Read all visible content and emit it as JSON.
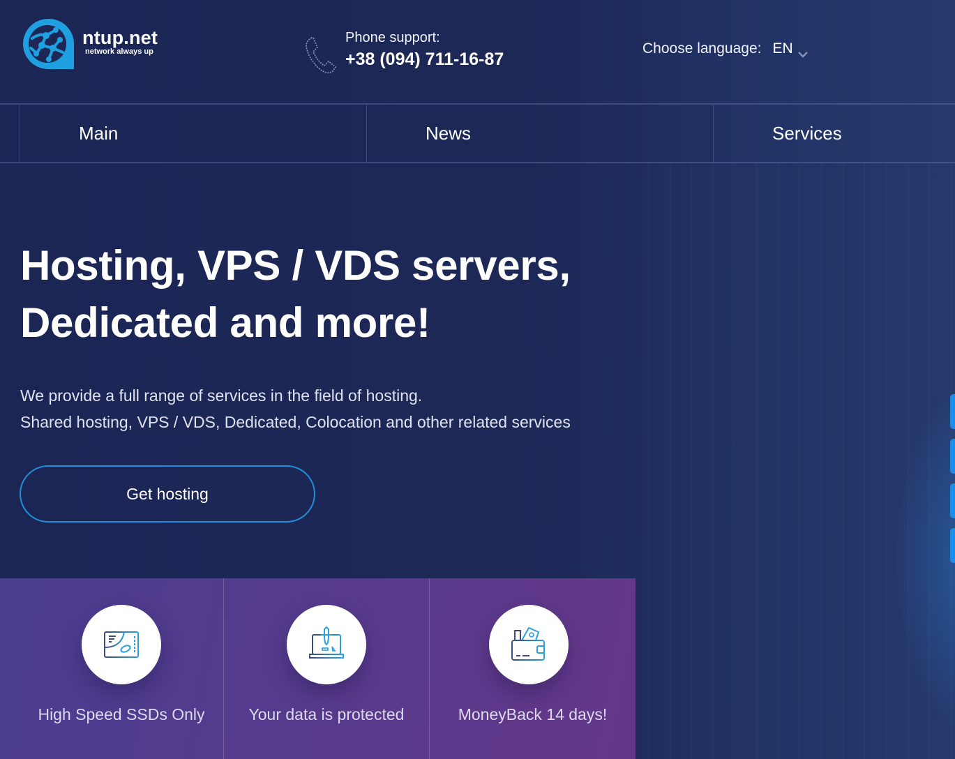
{
  "brand": {
    "name": "ntup.net",
    "tagline": "network always up",
    "icon": "globe-network-logo",
    "color": "#1fa0e0"
  },
  "header": {
    "phone": {
      "icon": "phone-icon",
      "label": "Phone support:",
      "number": "+38 (094) 711-16-87"
    },
    "language": {
      "label": "Choose language:",
      "selected": "EN",
      "icon": "chevron-down-icon"
    }
  },
  "nav": {
    "items": [
      {
        "label": "Main"
      },
      {
        "label": "News"
      },
      {
        "label": "Services"
      }
    ]
  },
  "hero": {
    "title_line1": "Hosting, VPS / VDS servers,",
    "title_line2": "Dedicated and more!",
    "subtitle_line1": "We provide a full range of services in the field of hosting.",
    "subtitle_line2": "Shared hosting, VPS / VDS, Dedicated, Colocation and other related services",
    "cta_label": "Get hosting",
    "accent": "#1f8fd8"
  },
  "features": [
    {
      "icon": "ssd-drive-icon",
      "label": "High Speed SSDs Only"
    },
    {
      "icon": "laptop-shield-icon",
      "label": "Your data is protected"
    },
    {
      "icon": "wallet-money-icon",
      "label": "MoneyBack 14 days!"
    }
  ],
  "colors": {
    "background": "#1d2756",
    "features_gradient_start": "#4b3c8e",
    "features_gradient_end": "#653789",
    "side_tab": "#1a8ee8"
  }
}
